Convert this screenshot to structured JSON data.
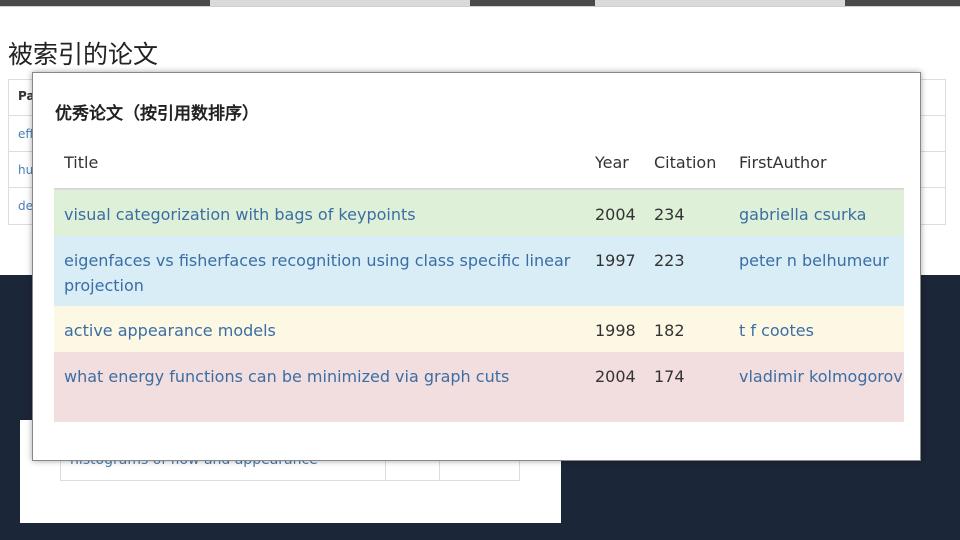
{
  "back": {
    "title": "被索引的论文",
    "header_stub": "Pa",
    "row_stubs": [
      "eff",
      "hu",
      "de"
    ],
    "lower_snippet": "histograms of flow and appearance"
  },
  "front": {
    "title": "优秀论文（按引用数排序）",
    "columns": [
      "Title",
      "Year",
      "Citation",
      "FirstAuthor"
    ],
    "rows": [
      {
        "title": "visual categorization with bags of keypoints",
        "year": "2004",
        "citation": "234",
        "author": "gabriella csurka",
        "bg": "#dff0d8"
      },
      {
        "title": "eigenfaces vs fisherfaces recognition using class specific linear projection",
        "year": "1997",
        "citation": "223",
        "author": "peter n belhumeur",
        "bg": "#d9edf7"
      },
      {
        "title": "active appearance models",
        "year": "1998",
        "citation": "182",
        "author": "t f cootes",
        "bg": "#fcf8e3"
      },
      {
        "title": "what energy functions can be minimized via graph cuts",
        "year": "2004",
        "citation": "174",
        "author": "vladimir kolmogorov",
        "bg": "#f2dede"
      }
    ]
  }
}
